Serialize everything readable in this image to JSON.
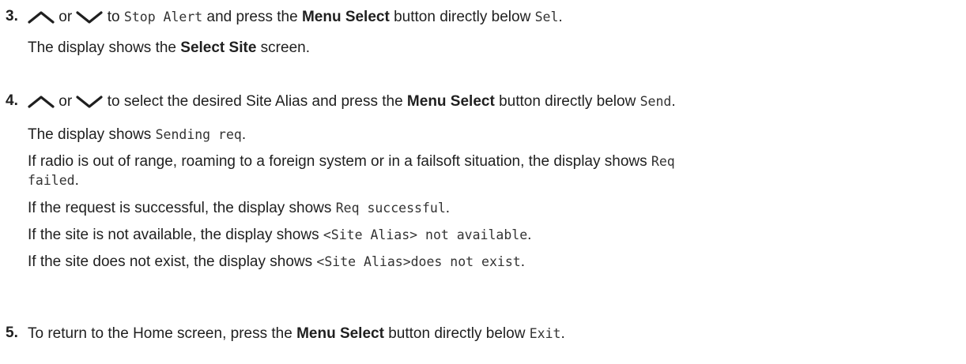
{
  "steps": [
    {
      "number": "3.",
      "line1": {
        "or": "or",
        "to": "to",
        "mono1": "Stop Alert",
        "mid": "and press the",
        "bold": "Menu Select",
        "after": "button directly below",
        "mono2": "Sel",
        "end": "."
      },
      "line2": {
        "pre": "The display shows the",
        "bold": "Select Site",
        "post": "screen."
      }
    },
    {
      "number": "4.",
      "line1": {
        "or": "or",
        "to": "to select the desired Site Alias and press the",
        "bold": "Menu Select",
        "after": "button directly below",
        "mono": "Send",
        "end": "."
      },
      "sub1": {
        "pre": "The display shows",
        "mono": "Sending req",
        "end": "."
      },
      "sub2": {
        "pre": "If radio is out of range, roaming to a foreign system or in a failsoft situation, the display shows",
        "mono": "Req"
      },
      "sub2b": {
        "mono": "failed",
        "end": "."
      },
      "sub3": {
        "pre": "If the request is successful, the display shows",
        "mono": "Req successful",
        "end": "."
      },
      "sub4": {
        "pre": "If the site is not available, the display shows",
        "mono": "<Site Alias> not available",
        "end": "."
      },
      "sub5": {
        "pre": "If the site does not exist, the display shows",
        "mono": "<Site Alias>does not exist",
        "end": "."
      }
    },
    {
      "number": "5.",
      "line1": {
        "pre": "To return to the Home screen, press the",
        "bold": "Menu Select",
        "after": "button directly below",
        "mono": "Exit",
        "end": "."
      }
    }
  ],
  "icons": {
    "up": "chevron-up-icon",
    "down": "chevron-down-icon"
  }
}
